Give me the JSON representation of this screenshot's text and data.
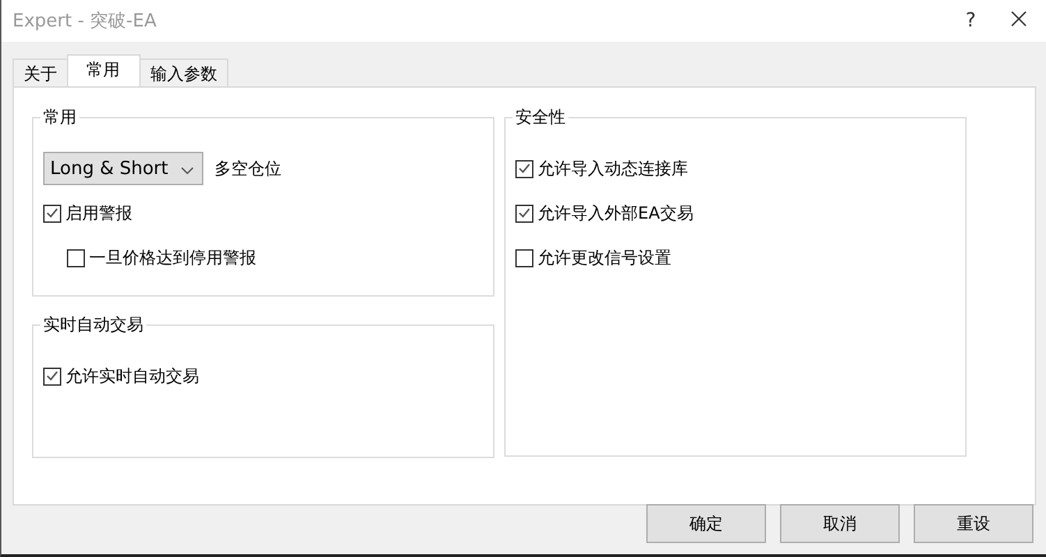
{
  "window": {
    "title": "Expert - 突破-EA",
    "help": "?"
  },
  "tabs": [
    {
      "label": "关于",
      "selected": false
    },
    {
      "label": "常用",
      "selected": true
    },
    {
      "label": "输入参数",
      "selected": false
    }
  ],
  "general": {
    "title": "常用",
    "position_select": {
      "value": "Long & Short"
    },
    "position_label": "多空仓位",
    "options": [
      {
        "label": "启用警报",
        "checked": true,
        "children": [
          {
            "label": "一旦价格达到停用警报",
            "checked": false
          }
        ]
      }
    ]
  },
  "live_trading": {
    "title": "实时自动交易",
    "options": [
      {
        "label": "允许实时自动交易",
        "checked": true
      }
    ]
  },
  "safety": {
    "title": "安全性",
    "options": [
      {
        "label": "允许导入动态连接库",
        "checked": true
      },
      {
        "label": "允许导入外部EA交易",
        "checked": true
      },
      {
        "label": "允许更改信号设置",
        "checked": false
      }
    ]
  },
  "buttons": [
    "确定",
    "取消",
    "重设"
  ]
}
